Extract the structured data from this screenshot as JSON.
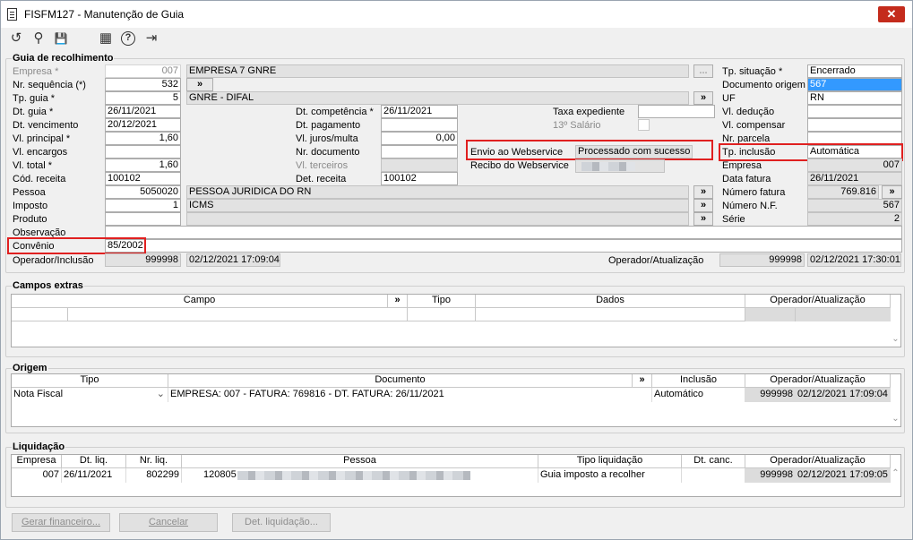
{
  "window": {
    "title": "FISFM127 - Manutenção de Guia",
    "close": "✕"
  },
  "toolbar": {
    "undo": "↺",
    "search": "⚲",
    "save": "💾",
    "calendar": "▦",
    "help": "?",
    "exit": "⇥"
  },
  "guia": {
    "section": "Guia de recolhimento",
    "empresa_label": "Empresa *",
    "empresa_code": "007",
    "empresa_name": "EMPRESA 7 GNRE",
    "nr_seq_label": "Nr. sequência (*)",
    "nr_seq": "532",
    "tp_guia_label": "Tp. guia *",
    "tp_guia_code": "5",
    "tp_guia_name": "GNRE - DIFAL",
    "dt_guia_label": "Dt. guia *",
    "dt_guia": "26/11/2021",
    "dt_venc_label": "Dt. vencimento",
    "dt_venc": "20/12/2021",
    "vl_principal_label": "Vl. principal *",
    "vl_principal": "1,60",
    "vl_encargos_label": "Vl. encargos",
    "vl_encargos": "",
    "vl_total_label": "Vl. total *",
    "vl_total": "1,60",
    "cod_receita_label": "Cód. receita",
    "cod_receita": "100102",
    "pessoa_label": "Pessoa",
    "pessoa_code": "5050020",
    "pessoa_name": "PESSOA JURIDICA DO RN",
    "imposto_label": "Imposto",
    "imposto_code": "1",
    "imposto_name": "ICMS",
    "produto_label": "Produto",
    "produto": "",
    "observacao_label": "Observação",
    "observacao": "",
    "convenio_label": "Convênio",
    "convenio": "85/2002",
    "operador_incl_label": "Operador/Inclusão",
    "operador_incl": "999998",
    "operador_incl_dt": "02/12/2021 17:09:04",
    "operador_atual_label": "Operador/Atualização",
    "operador_atual": "999998",
    "operador_atual_dt": "02/12/2021 17:30:01",
    "dt_competencia_label": "Dt. competência *",
    "dt_competencia": "26/11/2021",
    "dt_pagamento_label": "Dt. pagamento",
    "dt_pagamento": "",
    "vl_juros_label": "Vl. juros/multa",
    "vl_juros": "0,00",
    "nr_documento_label": "Nr. documento",
    "nr_documento": "",
    "vl_terceiros_label": "Vl. terceiros",
    "vl_terceiros": "",
    "det_receita_label": "Det. receita",
    "det_receita": "100102",
    "taxa_label": "Taxa expediente",
    "taxa": "",
    "salario_label": "13º Salário",
    "envio_label": "Envio ao Webservice",
    "envio": "Processado com sucesso",
    "recibo_label": "Recibo do Webservice",
    "tp_situacao_label": "Tp. situação *",
    "tp_situacao": "Encerrado",
    "doc_origem_label": "Documento origem",
    "doc_origem": "567",
    "uf_label": "UF",
    "uf": "RN",
    "vl_deducao_label": "Vl. dedução",
    "vl_deducao": "",
    "vl_compensar_label": "Vl. compensar",
    "vl_compensar": "",
    "nr_parcela_label": "Nr. parcela",
    "nr_parcela": "",
    "tp_inclusao_label": "Tp. inclusão",
    "tp_inclusao": "Automática",
    "empresa2_label": "Empresa",
    "empresa2": "007",
    "data_fatura_label": "Data fatura",
    "data_fatura": "26/11/2021",
    "numero_fatura_label": "Número fatura",
    "numero_fatura": "769.816",
    "numero_nf_label": "Número N.F.",
    "numero_nf": "567",
    "serie_label": "Série",
    "serie": "2",
    "more": "»",
    "ellipsis": "..."
  },
  "campos_extras": {
    "section": "Campos extras",
    "headers": {
      "campo": "Campo",
      "more": "»",
      "tipo": "Tipo",
      "dados": "Dados",
      "operador": "Operador/Atualização"
    }
  },
  "origem": {
    "section": "Origem",
    "headers": {
      "tipo": "Tipo",
      "documento": "Documento",
      "more": "»",
      "inclusao": "Inclusão",
      "operador": "Operador/Atualização"
    },
    "row": {
      "tipo": "Nota Fiscal",
      "documento": "EMPRESA: 007 - FATURA: 769816 - DT. FATURA: 26/11/2021",
      "inclusao": "Automático",
      "operador": "999998",
      "operador_dt": "02/12/2021 17:09:04"
    }
  },
  "liquidacao": {
    "section": "Liquidação",
    "headers": {
      "empresa": "Empresa",
      "dt_liq": "Dt. liq.",
      "nr_liq": "Nr. liq.",
      "pessoa": "Pessoa",
      "tipo": "Tipo liquidação",
      "dt_canc": "Dt. canc.",
      "operador": "Operador/Atualização"
    },
    "row": {
      "empresa": "007",
      "dt_liq": "26/11/2021",
      "nr_liq": "802299",
      "pessoa": "120805",
      "tipo": "Guia imposto a recolher",
      "dt_canc": "",
      "operador": "999998",
      "operador_dt": "02/12/2021 17:09:05"
    }
  },
  "buttons": {
    "gerar": "Gerar financeiro...",
    "cancelar": "Cancelar",
    "det_liq": "Det. liquidação..."
  }
}
